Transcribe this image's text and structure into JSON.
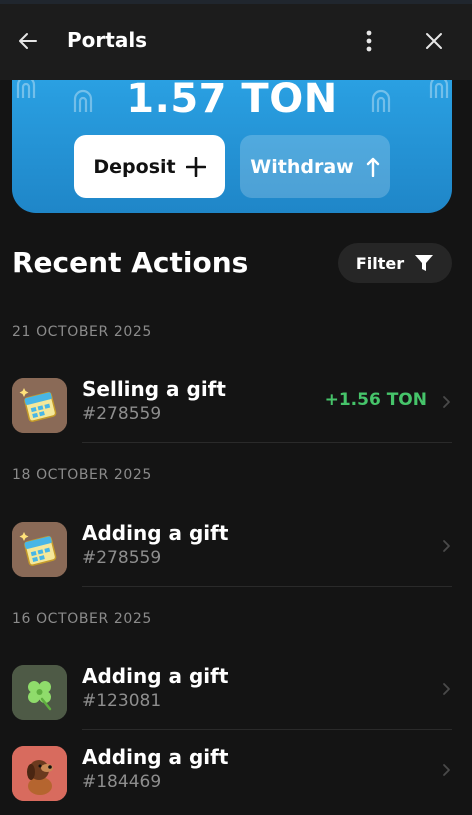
{
  "header": {
    "title": "Portals",
    "back_icon": "arrow-left-icon",
    "more_icon": "vertical-dots-icon",
    "close_icon": "close-icon"
  },
  "balance": {
    "amount": "1.57 TON",
    "deposit_label": "Deposit",
    "withdraw_label": "Withdraw",
    "accent_color": "#2399d9"
  },
  "recent": {
    "title": "Recent Actions",
    "filter_label": "Filter"
  },
  "groups": [
    {
      "date": "21 OCTOBER 2025",
      "items": [
        {
          "title": "Selling a gift",
          "id": "#278559",
          "amount": "+1.56 TON",
          "thumb": "calendar-gift-icon"
        }
      ]
    },
    {
      "date": "18 OCTOBER 2025",
      "items": [
        {
          "title": "Adding a gift",
          "id": "#278559",
          "thumb": "calendar-gift-icon"
        }
      ]
    },
    {
      "date": "16 OCTOBER 2025",
      "items": [
        {
          "title": "Adding a gift",
          "id": "#123081",
          "thumb": "clover-gift-icon"
        },
        {
          "title": "Adding a gift",
          "id": "#184469",
          "thumb": "dog-gift-icon"
        }
      ]
    }
  ],
  "colors": {
    "positive": "#46c46a",
    "background": "#141414"
  }
}
